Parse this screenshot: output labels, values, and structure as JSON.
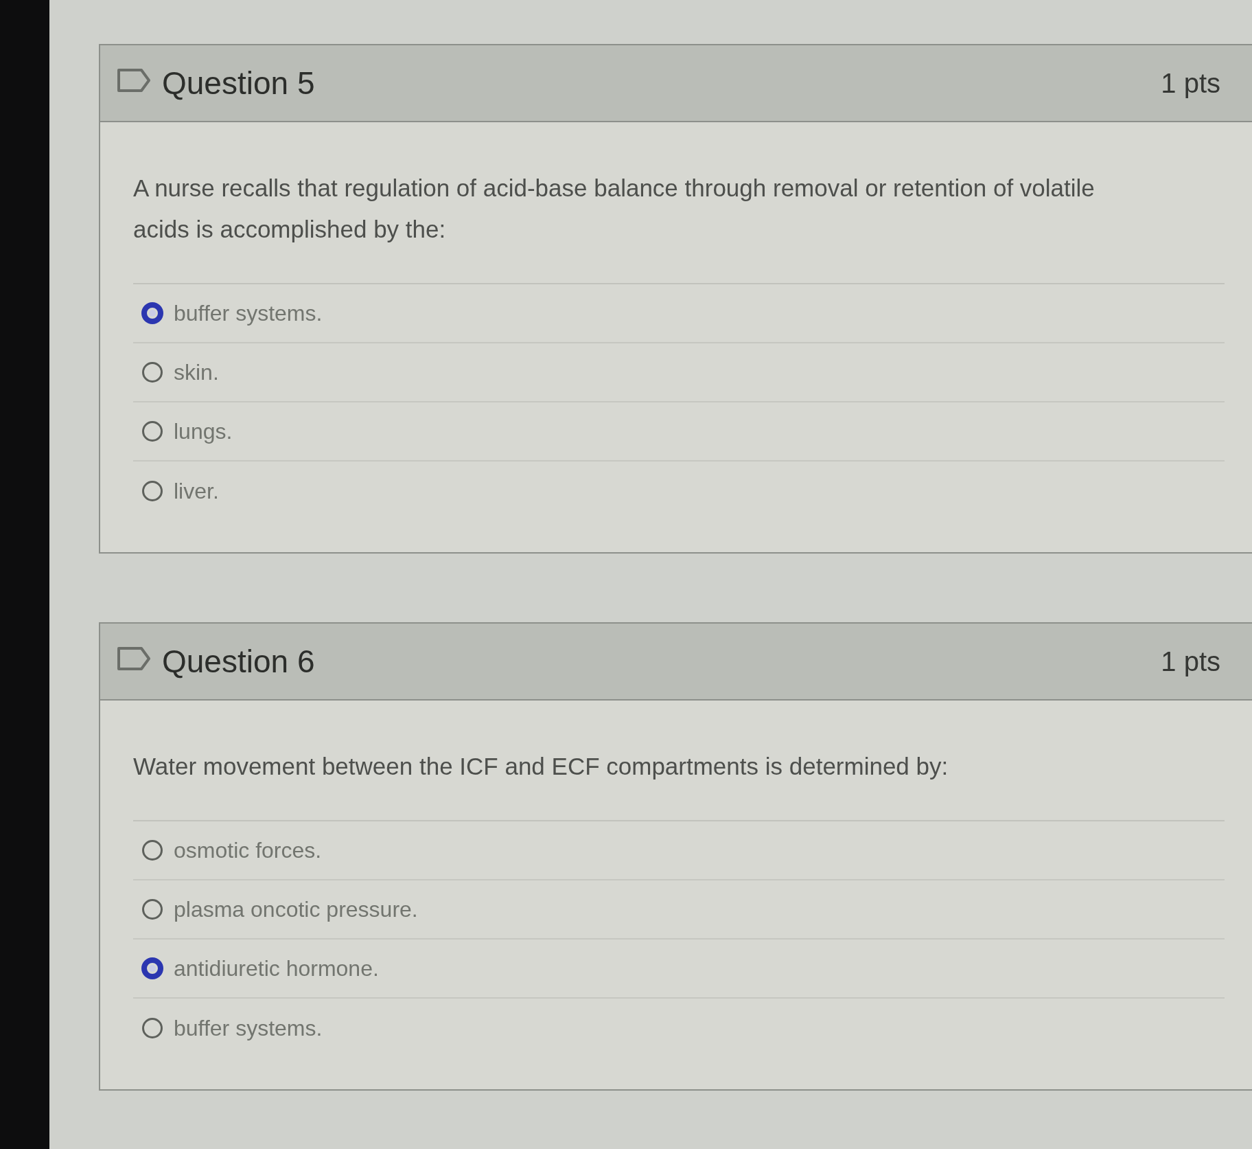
{
  "questions": [
    {
      "title": "Question 5",
      "points": "1 pts",
      "flagged": false,
      "prompt": "A nurse recalls that regulation of acid-base balance through removal or retention of volatile acids is accomplished by the:",
      "answers": [
        {
          "text": "buffer systems.",
          "selected": true
        },
        {
          "text": "skin.",
          "selected": false
        },
        {
          "text": "lungs.",
          "selected": false
        },
        {
          "text": "liver.",
          "selected": false
        }
      ]
    },
    {
      "title": "Question 6",
      "points": "1 pts",
      "flagged": false,
      "prompt": "Water movement between the ICF and ECF compartments is determined by:",
      "answers": [
        {
          "text": "osmotic forces.",
          "selected": false
        },
        {
          "text": "plasma oncotic pressure.",
          "selected": false
        },
        {
          "text": "antidiuretic hormone.",
          "selected": true
        },
        {
          "text": "buffer systems.",
          "selected": false
        }
      ]
    }
  ]
}
